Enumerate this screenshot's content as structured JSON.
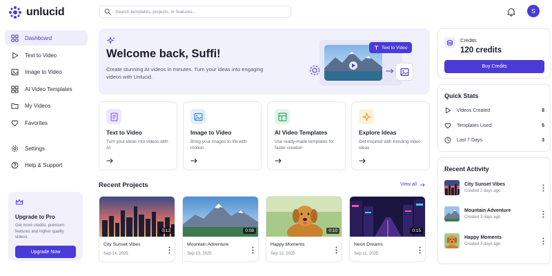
{
  "app": {
    "name": "unlucid",
    "brand_color": "#4b3bd6"
  },
  "topbar": {
    "search_placeholder": "Search templates, projects, or features...",
    "avatar_initial": "S"
  },
  "sidebar": {
    "items": [
      {
        "label": "Dashboard",
        "icon": "home-icon",
        "active": true
      },
      {
        "label": "Text to Video",
        "icon": "play-icon"
      },
      {
        "label": "Image to Video",
        "icon": "image-icon"
      },
      {
        "label": "AI Video Templates",
        "icon": "grid-icon"
      },
      {
        "label": "My Videos",
        "icon": "folder-icon"
      },
      {
        "label": "Favorites",
        "icon": "heart-icon"
      },
      {
        "label": "Settings",
        "icon": "gear-icon"
      },
      {
        "label": "Help & Support",
        "icon": "help-icon"
      }
    ],
    "upgrade": {
      "title": "Upgrade to Pro",
      "description": "Get more credits, premium features and higher quality videos.",
      "button": "Upgrade Now"
    }
  },
  "welcome": {
    "title": "Welcome back, Suffi!",
    "subtitle": "Create stunning AI videos in minutes. Turn your ideas into engaging videos with Unlucid.",
    "hero_chip": "Text to Video"
  },
  "features": [
    {
      "title": "Text to Video",
      "description": "Turn your ideas into videos with AI",
      "color": "#8a5cf6",
      "bg": "#ede7fe",
      "icon": "document-icon"
    },
    {
      "title": "Image to Video",
      "description": "Bring your images to life with motion",
      "color": "#3b82f6",
      "bg": "#e2eefe",
      "icon": "image-icon"
    },
    {
      "title": "AI Video Templates",
      "description": "Use ready-made templates for faster creation",
      "color": "#22a45d",
      "bg": "#dff5e8",
      "icon": "template-icon"
    },
    {
      "title": "Explore Ideas",
      "description": "Get inspired with trending video ideas",
      "color": "#f0a020",
      "bg": "#fdf1dc",
      "icon": "sparkle-icon"
    }
  ],
  "recent_projects": {
    "title": "Recent Projects",
    "view_all": "View all",
    "items": [
      {
        "name": "City Sunset Vibes",
        "date": "Sep 14, 2025",
        "duration": "0:12"
      },
      {
        "name": "Mountain Adventure",
        "date": "Sep 13, 2025",
        "duration": "0:08"
      },
      {
        "name": "Happy Moments",
        "date": "Sep 12, 2025",
        "duration": "0:10"
      },
      {
        "name": "Neon Dreams",
        "date": "Sep 11, 2025",
        "duration": "0:15"
      }
    ]
  },
  "credits": {
    "label": "Credits",
    "value": "120 credits",
    "button": "Buy Credits"
  },
  "quick_stats": {
    "title": "Quick Stats",
    "items": [
      {
        "label": "Videos Created",
        "value": "8",
        "icon": "play-icon"
      },
      {
        "label": "Templates Used",
        "value": "5",
        "icon": "heart-icon"
      },
      {
        "label": "Last 7 Days",
        "value": "3",
        "icon": "clock-icon"
      }
    ]
  },
  "recent_activity": {
    "title": "Recent Activity",
    "items": [
      {
        "name": "City Sunset Vibes",
        "date": "Created 2 days ago"
      },
      {
        "name": "Mountain Adventure",
        "date": "Created 3 days ago"
      },
      {
        "name": "Happy Moments",
        "date": "Created 3 days ago"
      }
    ]
  }
}
